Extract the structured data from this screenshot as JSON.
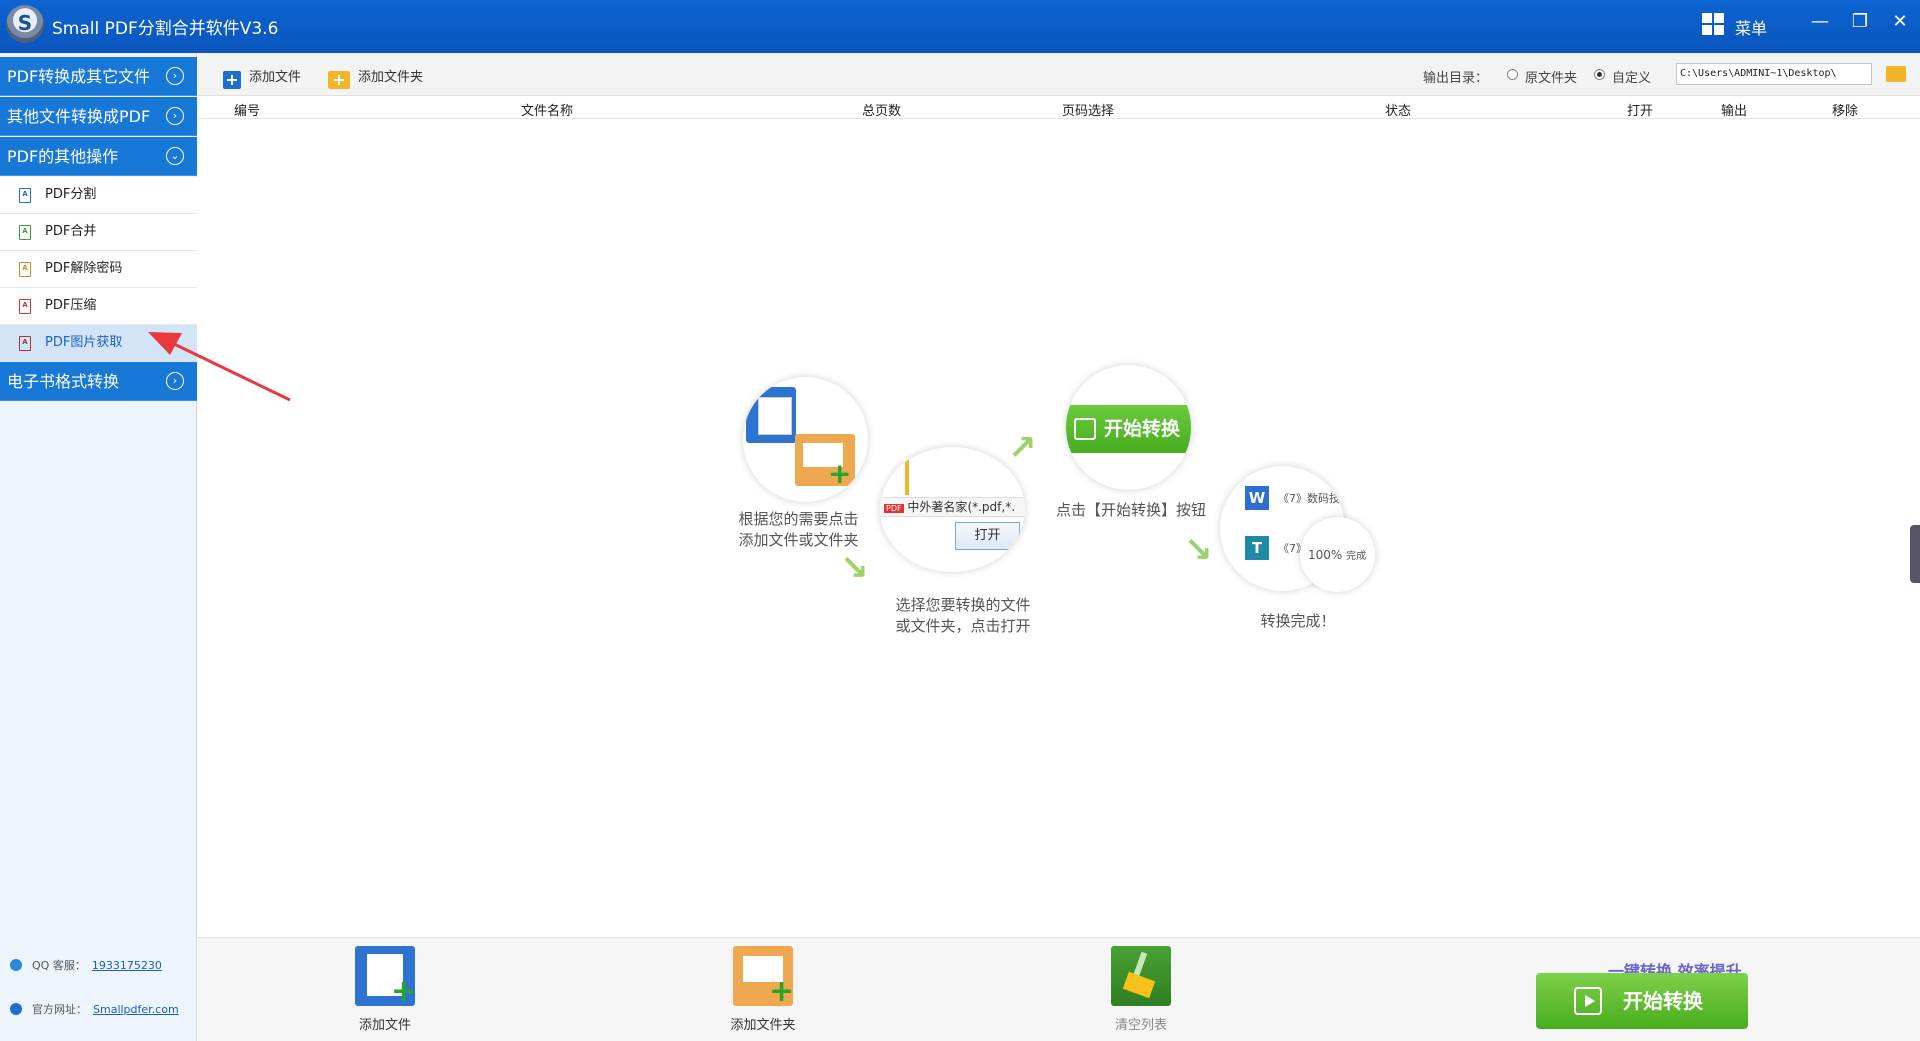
{
  "app": {
    "title": "Small PDF分割合并软件V3.6",
    "logo_letter": "S",
    "menu_label": "菜单",
    "win_min": "—",
    "win_restore": "❐",
    "win_close": "✕"
  },
  "sidebar": {
    "categories": [
      {
        "label": "PDF转换成其它文件",
        "chevron": "›"
      },
      {
        "label": "其他文件转换成PDF",
        "chevron": "›"
      },
      {
        "label": "PDF的其他操作",
        "chevron": "⌄"
      },
      {
        "label": "电子书格式转换",
        "chevron": "›"
      }
    ],
    "items": [
      {
        "label": "PDF分割",
        "icon_color": "#2d6cc4"
      },
      {
        "label": "PDF合并",
        "icon_color": "#3aa048"
      },
      {
        "label": "PDF解除密码",
        "icon_color": "#d08a2a"
      },
      {
        "label": "PDF压缩",
        "icon_color": "#c8383a"
      },
      {
        "label": "PDF图片获取",
        "icon_color": "#a0353c",
        "active": true
      }
    ],
    "footer": {
      "qq_label": "QQ 客服：",
      "qq_value": "1933175230",
      "site_label": "官方网址：",
      "site_value": "Smallpdfer.com"
    }
  },
  "toolbar": {
    "add_file": "添加文件",
    "add_folder": "添加文件夹",
    "output_label": "输出目录：",
    "option_original": "原文件夹",
    "option_custom": "自定义",
    "selected_option": "custom",
    "path_value": "C:\\Users\\ADMINI~1\\Desktop\\"
  },
  "table": {
    "headers": [
      "编号",
      "文件名称",
      "总页数",
      "页码选择",
      "状态",
      "打开",
      "输出",
      "移除"
    ]
  },
  "guide": {
    "step1": "根据您的需要点击\n添加文件或文件夹",
    "step2": "选择您要转换的文件\n或文件夹，点击打开",
    "step3": "点击【开始转换】按钮",
    "step4": "转换完成！",
    "circle2_file": "中外著名家",
    "circle2_ext": "(*.pdf,*.",
    "circle2_open": "打开",
    "circle3_start": "开始转换",
    "circle4_item1": "《7》数码技",
    "circle4_item2": "《7》",
    "circle4_progress": "100%",
    "circle4_done": "完成"
  },
  "bottom": {
    "add_file": "添加文件",
    "add_folder": "添加文件夹",
    "clear_list": "清空列表",
    "slogan": "一键转换  效率提升",
    "start": "开始转换"
  },
  "colors": {
    "titlebar": "#0d64d0",
    "sidebar_category": "#1778d8",
    "active_item": "#d3e4f6",
    "start_button": "#5cbc2e",
    "annotation_arrow": "#e83a3a"
  }
}
